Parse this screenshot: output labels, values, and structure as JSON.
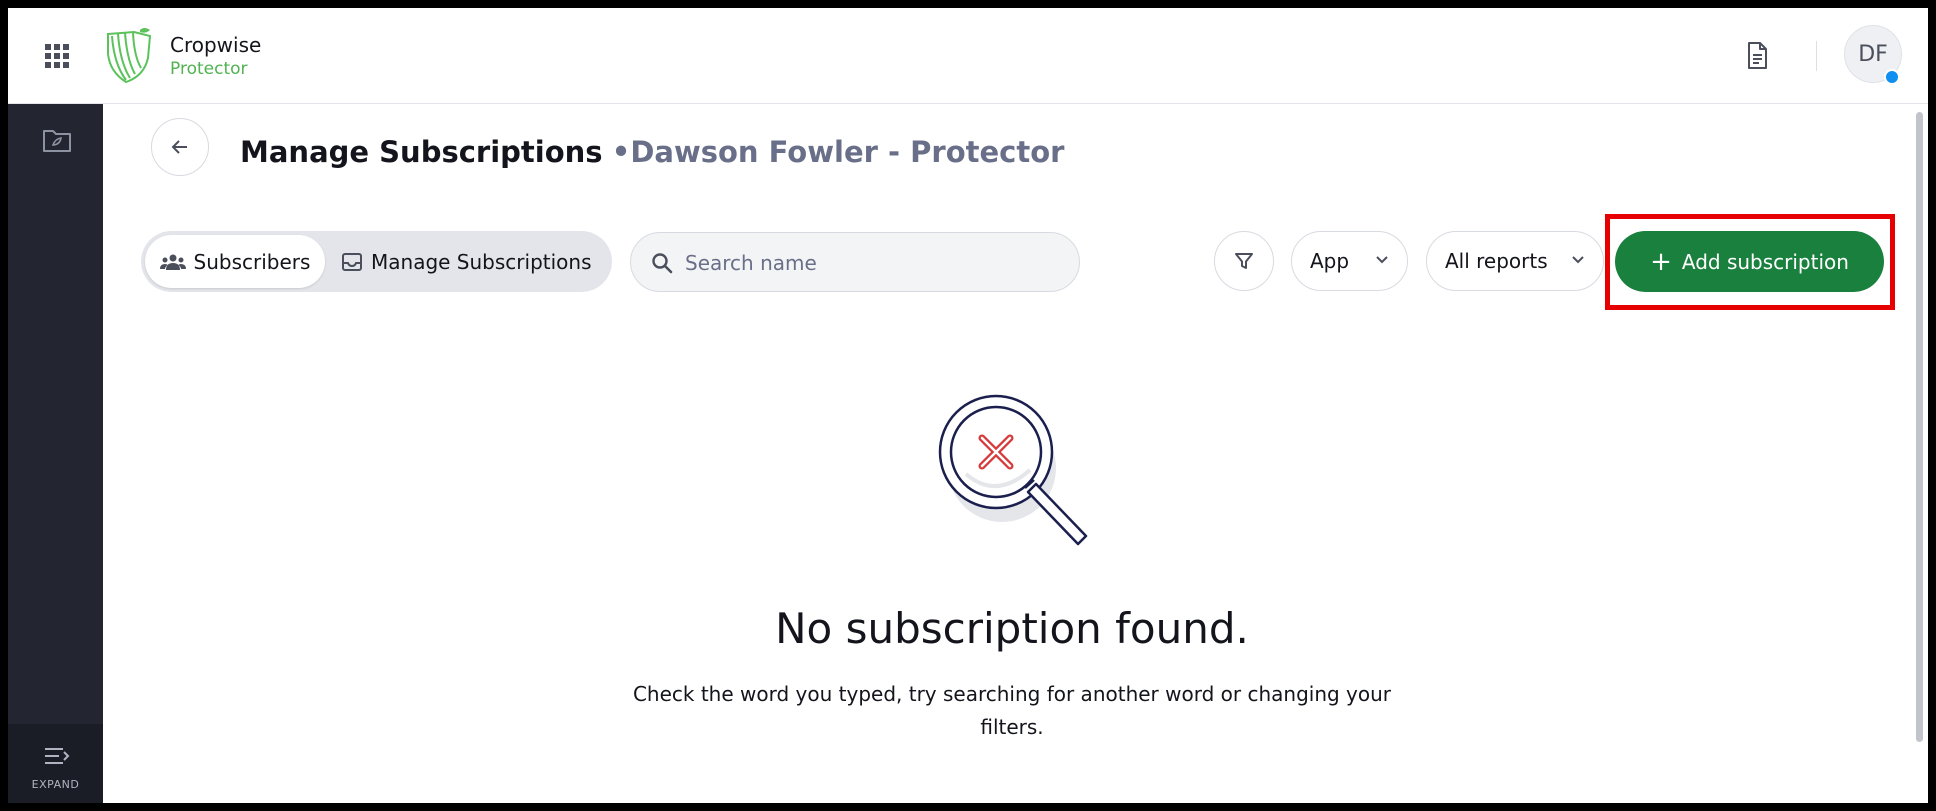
{
  "header": {
    "logo_title": "Cropwise",
    "logo_subtitle": "Protector",
    "avatar_initials": "DF"
  },
  "sidebar": {
    "expand_label": "EXPAND"
  },
  "page": {
    "title": "Manage Subscriptions",
    "separator": "•",
    "subtitle": "Dawson Fowler - Protector"
  },
  "toolbar": {
    "tabs": [
      {
        "label": "Subscribers",
        "active": true
      },
      {
        "label": "Manage Subscriptions",
        "active": false
      }
    ],
    "search_placeholder": "Search name",
    "app_dropdown": "App",
    "reports_dropdown": "All reports",
    "add_button": "Add subscription",
    "add_button_icon": "+"
  },
  "empty_state": {
    "title": "No subscription found.",
    "description_line1": "Check the word you typed, try searching for another word or changing your",
    "description_line2": "filters."
  },
  "colors": {
    "primary_green": "#19803d",
    "brand_green": "#4fb34f",
    "sidebar_bg": "#232631",
    "highlight_red": "#e60000",
    "notification_blue": "#0f8ff0",
    "icon_navy": "#1a1f4e",
    "error_red": "#d63a3a"
  },
  "icons": [
    "apps-grid-icon",
    "cropwise-logo-icon",
    "document-icon",
    "folder-icon",
    "expand-menu-icon",
    "arrow-left-icon",
    "users-icon",
    "inbox-icon",
    "search-icon",
    "filter-icon",
    "chevron-down-icon",
    "plus-icon",
    "magnifier-error-icon"
  ]
}
